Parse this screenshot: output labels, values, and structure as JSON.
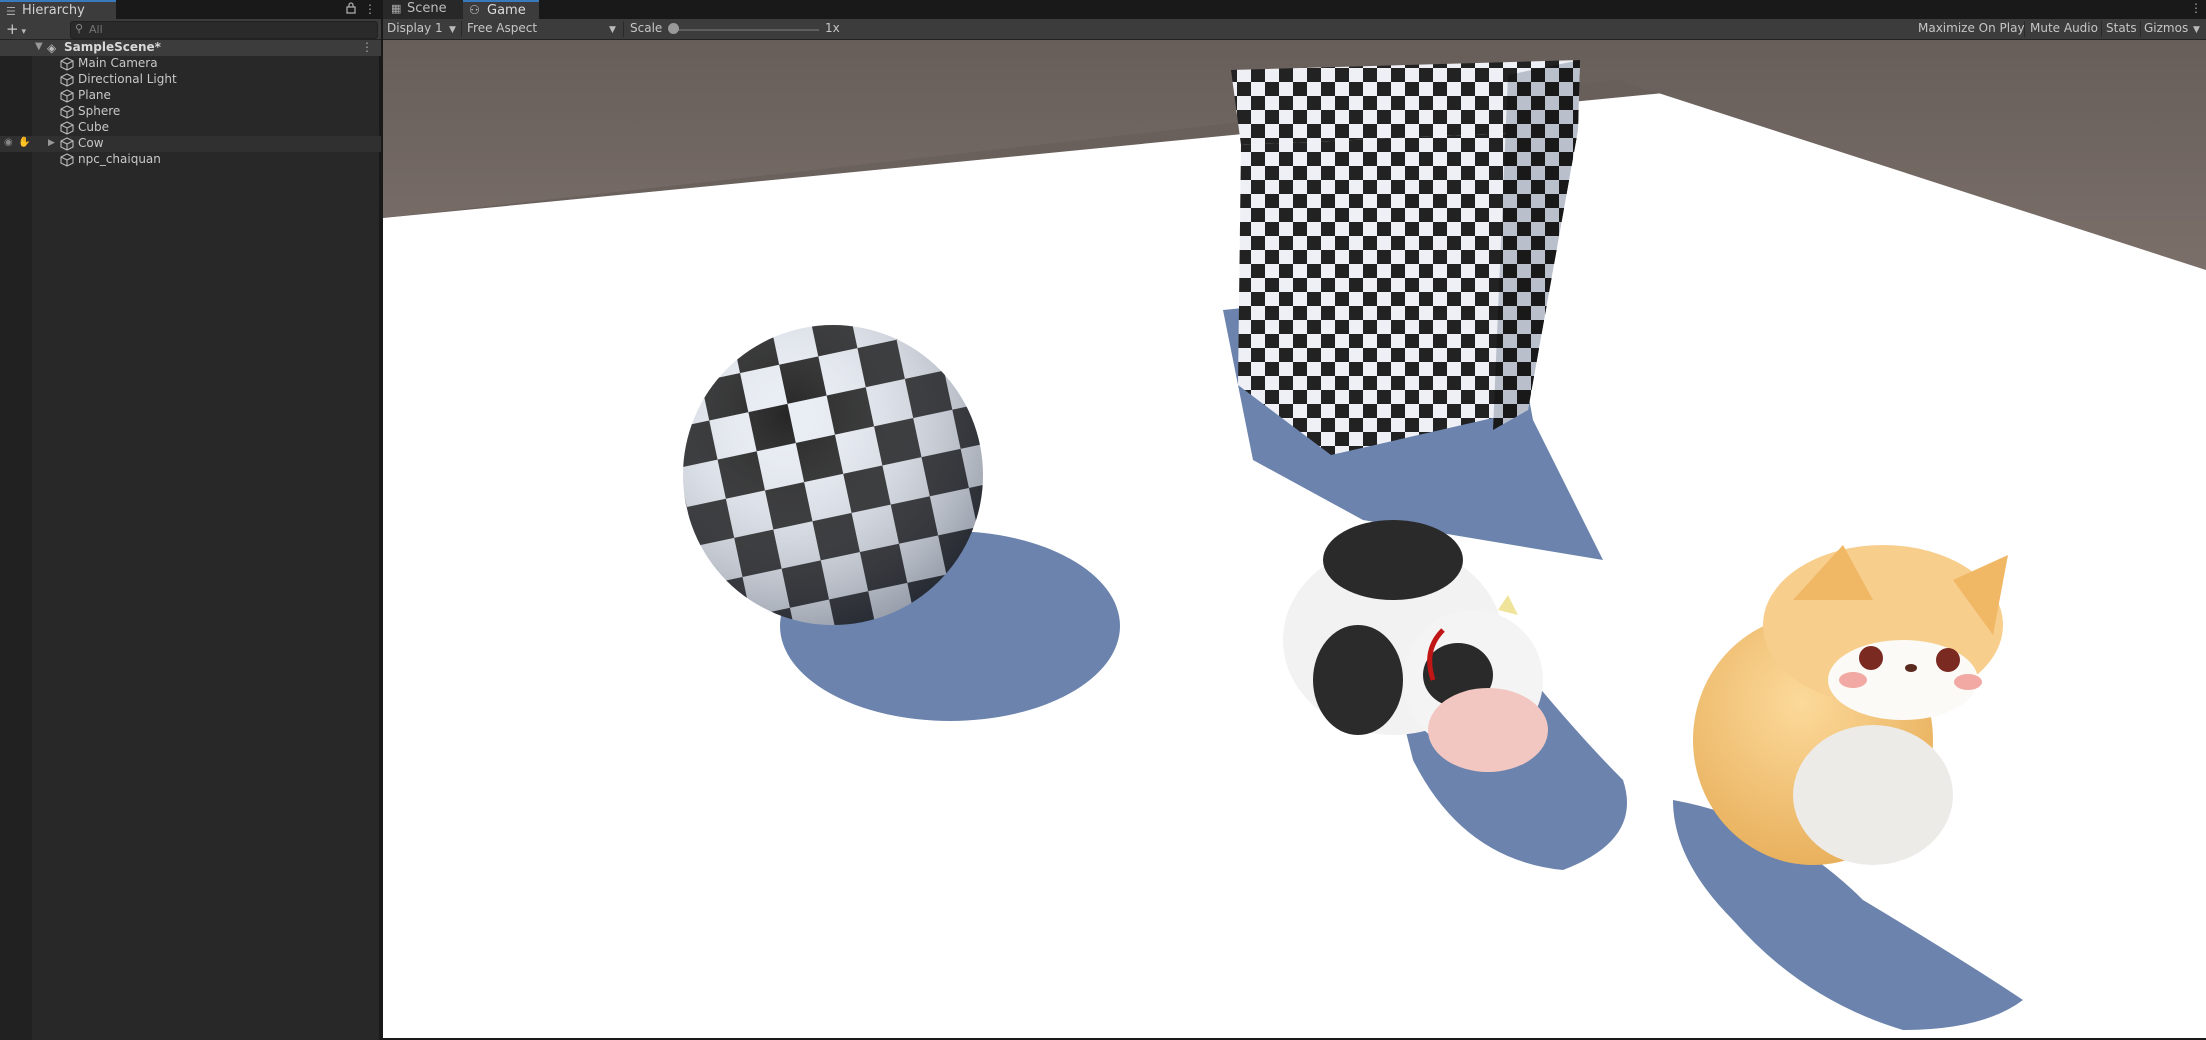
{
  "hierarchy": {
    "tab_label": "Hierarchy",
    "add_label": "+",
    "search_placeholder": "All",
    "scene_name": "SampleScene*",
    "items": [
      {
        "label": "Main Camera"
      },
      {
        "label": "Directional Light"
      },
      {
        "label": "Plane"
      },
      {
        "label": "Sphere"
      },
      {
        "label": "Cube"
      },
      {
        "label": "Cow"
      },
      {
        "label": "npc_chaiquan"
      }
    ]
  },
  "game_view": {
    "tabs": [
      {
        "label": "Scene"
      },
      {
        "label": "Game"
      }
    ],
    "display": "Display 1",
    "aspect": "Free Aspect",
    "scale_label": "Scale",
    "scale_value": "1x",
    "toolbar_buttons": {
      "maximize": "Maximize On Play",
      "mute": "Mute Audio",
      "stats": "Stats",
      "gizmos": "Gizmos"
    }
  },
  "colors": {
    "accent": "#3a79bb",
    "panel": "#282828",
    "toolbar": "#3c3c3c",
    "sky": "#6e625d",
    "floor": "#ffffff",
    "shadow": "#6b83ad"
  },
  "icons": {
    "hierarchy": "list-icon",
    "lock": "lock-icon",
    "menu": "kebab-icon",
    "gameobject": "cube-icon",
    "visibility": "eye-icon",
    "pickable": "hand-icon"
  }
}
